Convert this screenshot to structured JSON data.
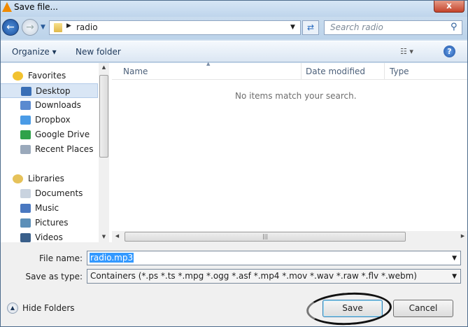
{
  "window": {
    "title": "Save file...",
    "close": "x"
  },
  "nav": {
    "back": "←",
    "forward": "→",
    "breadcrumb": "radio",
    "search_placeholder": "Search radio"
  },
  "toolbar": {
    "organize": "Organize ▾",
    "new_folder": "New folder",
    "views": "☷ ▾",
    "help": "?"
  },
  "sidebar": {
    "items": [
      {
        "label": "Favorites",
        "group": true,
        "color": "#f2c230"
      },
      {
        "label": "Desktop",
        "selected": true,
        "color": "#3a6fb6"
      },
      {
        "label": "Downloads",
        "color": "#5a8ad0"
      },
      {
        "label": "Dropbox",
        "color": "#4a9be6"
      },
      {
        "label": "Google Drive",
        "color": "#2fa24a"
      },
      {
        "label": "Recent Places",
        "color": "#9aa9bb"
      },
      {
        "label": "Libraries",
        "group": true,
        "color": "#e6c25a"
      },
      {
        "label": "Documents",
        "color": "#c9d3df"
      },
      {
        "label": "Music",
        "color": "#4a78c0"
      },
      {
        "label": "Pictures",
        "color": "#5c8fb8"
      },
      {
        "label": "Videos",
        "color": "#3a5f8a"
      }
    ]
  },
  "columns": [
    "Name",
    "Date modified",
    "Type"
  ],
  "empty_message": "No items match your search.",
  "form": {
    "file_name_label": "File name:",
    "file_name": "radio.mp3",
    "type_label": "Save as type:",
    "type_value": "Containers (*.ps *.ts *.mpg *.ogg *.asf *.mp4 *.mov *.wav *.raw *.flv *.webm)"
  },
  "buttons": {
    "hide_folders": "Hide Folders",
    "save": "Save",
    "cancel": "Cancel"
  }
}
